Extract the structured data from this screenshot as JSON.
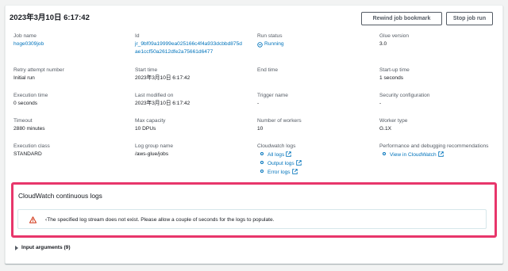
{
  "header": {
    "title": "2023年3月10日 6:17:42"
  },
  "buttons": {
    "rewind": "Rewind job bookmark",
    "stop": "Stop job run"
  },
  "details": {
    "job_name": {
      "label": "Job name",
      "value": "hoge0309job"
    },
    "id": {
      "label": "Id",
      "value_line1": "jr_9bf09a19999ea025166c4f4a933dcbbd875d",
      "value_line2": "ae1ccf50a2612dfe2a75661d6477"
    },
    "run_status": {
      "label": "Run status",
      "value": "Running"
    },
    "glue_version": {
      "label": "Glue version",
      "value": "3.0"
    },
    "retry": {
      "label": "Retry attempt number",
      "value": "Initial run"
    },
    "start_time": {
      "label": "Start time",
      "value": "2023年3月10日 6:17:42"
    },
    "end_time": {
      "label": "End time",
      "value": ""
    },
    "startup_time": {
      "label": "Start-up time",
      "value": "1 seconds"
    },
    "execution_time": {
      "label": "Execution time",
      "value": "0 seconds"
    },
    "last_modified": {
      "label": "Last modified on",
      "value": "2023年3月10日 6:17:42"
    },
    "trigger_name": {
      "label": "Trigger name",
      "value": "-"
    },
    "security_config": {
      "label": "Security configuration",
      "value": "-"
    },
    "timeout": {
      "label": "Timeout",
      "value": "2880 minutes"
    },
    "max_capacity": {
      "label": "Max capacity",
      "value": "10 DPUs"
    },
    "num_workers": {
      "label": "Number of workers",
      "value": "10"
    },
    "worker_type": {
      "label": "Worker type",
      "value": "G.1X"
    },
    "execution_class": {
      "label": "Execution class",
      "value": "STANDARD"
    },
    "log_group": {
      "label": "Log group name",
      "value": "/aws-glue/jobs"
    },
    "cloudwatch_logs": {
      "label": "Cloudwatch logs",
      "items": [
        "All logs",
        "Output logs",
        "Error logs"
      ]
    },
    "perf_debug": {
      "label": "Performance and debugging recommendations",
      "link": "View in CloudWatch"
    }
  },
  "cloudwatch_section": {
    "title": "CloudWatch continuous logs",
    "alert_message": "‹The specified log stream does not exist. Please allow a couple of seconds for the logs to populate."
  },
  "input_arguments": {
    "label": "Input arguments (9)"
  },
  "colors": {
    "link": "#0073bb",
    "highlight": "#e8366b",
    "warning": "#d13212"
  }
}
